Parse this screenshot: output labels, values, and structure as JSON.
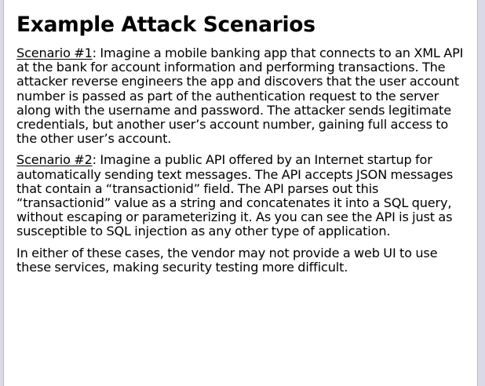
{
  "slide": {
    "title": "Example Attack Scenarios",
    "scenario1": {
      "label": "Scenario #1",
      "text": ": Imagine a mobile banking app that connects to an XML API at the bank for account information and performing transactions. The attacker reverse engineers the app and discovers that the user account number is passed as part of the authentication request to the server along with the username and password. The attacker sends legitimate credentials, but another user’s account number, gaining full access to the other user’s account."
    },
    "scenario2": {
      "label": "Scenario #2",
      "text": ": Imagine a public API offered by an Internet startup for automatically sending text messages. The API accepts JSON messages that contain a “transactionid” field. The API parses out this “transactionid” value as a string and concatenates it into a SQL query, without escaping or parameterizing it. As you can see the API is just as susceptible to SQL injection as any other type of application."
    },
    "conclusion": "In either of these cases, the vendor may not provide a web UI to use these services, making security testing more difficult."
  }
}
